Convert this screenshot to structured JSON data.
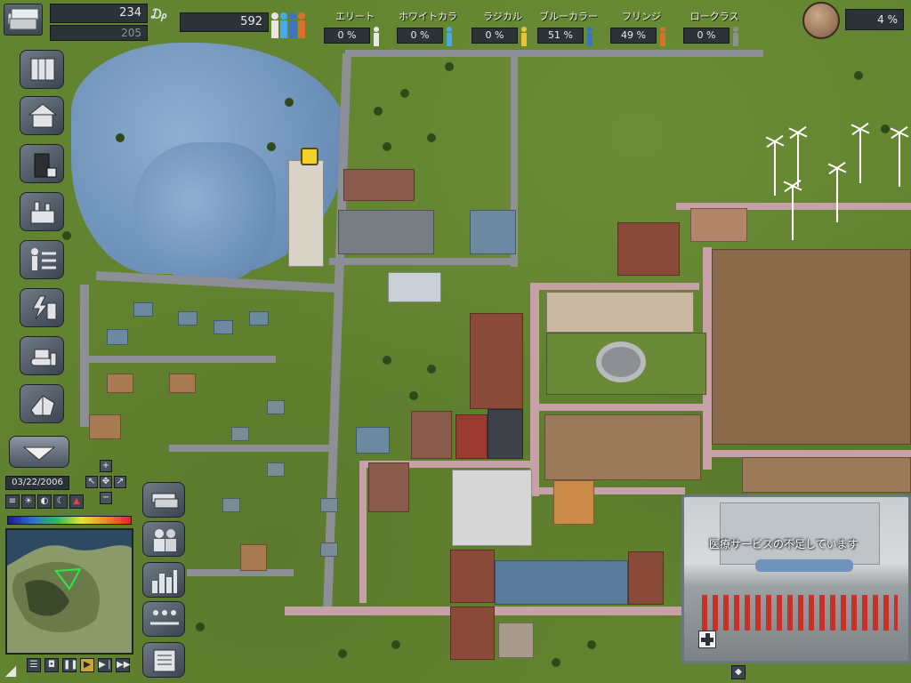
{
  "top_bar": {
    "money": "234",
    "money_sub": "205",
    "currency_symbol": "₯",
    "population": "592",
    "approval": "4 %"
  },
  "classes": [
    {
      "name": "エリート",
      "value": "0 %",
      "color": "#e8e8e8"
    },
    {
      "name": "ホワイトカラー",
      "value": "0 %",
      "color": "#48a8e8"
    },
    {
      "name": "ラジカル",
      "value": "0 %",
      "color": "#e8c23a"
    },
    {
      "name": "ブルーカラー",
      "value": "51 %",
      "color": "#3c72c8"
    },
    {
      "name": "フリンジ",
      "value": "49 %",
      "color": "#d8722a"
    },
    {
      "name": "ロークラス",
      "value": "0 %",
      "color": "#8c8f95"
    }
  ],
  "sidebar": {
    "items": [
      {
        "icon": "residential-zone-icon"
      },
      {
        "icon": "house-icon"
      },
      {
        "icon": "locked-building-icon"
      },
      {
        "icon": "industry-icon"
      },
      {
        "icon": "transport-icon"
      },
      {
        "icon": "utilities-icon"
      },
      {
        "icon": "bulldozer-icon"
      },
      {
        "icon": "terrain-icon"
      }
    ]
  },
  "controls": {
    "date": "03/22/2006",
    "pad_labels": {
      "up": "+",
      "down": "−",
      "center": "✥",
      "left": "↖",
      "right": "↗"
    }
  },
  "news": {
    "caption": "医療サービスの不足しています"
  },
  "colors": {
    "panel": "#3e4750",
    "road": "#8c8f95",
    "pink_road": "#c8a0a8",
    "grass": "#62832f",
    "water": "#6f93bb"
  }
}
